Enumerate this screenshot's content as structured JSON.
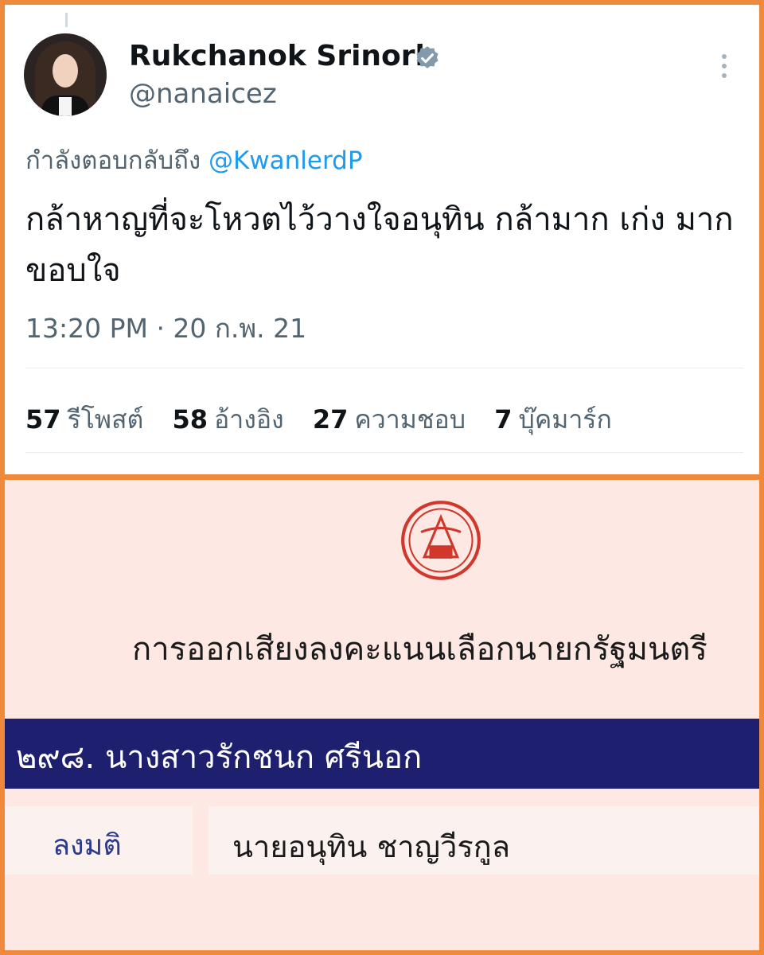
{
  "tweet": {
    "display_name": "Rukchanok Srinork",
    "handle": "@nanaicez",
    "replying_prefix": "กำลังตอบกลับถึง",
    "replying_to": "@KwanlerdP",
    "text": "กล้าหาญที่จะโหวตไว้วางใจอนุทิน กล้ามาก เก่ง มาก ขอบใจ",
    "timestamp": "13:20 PM · 20 ก.พ. 21",
    "stats": [
      {
        "count": "57",
        "label": "รีโพสต์"
      },
      {
        "count": "58",
        "label": "อ้างอิง"
      },
      {
        "count": "27",
        "label": "ความชอบ"
      },
      {
        "count": "7",
        "label": "บุ๊คมาร์ก"
      }
    ],
    "icons": {
      "verified": "verified-badge-icon",
      "more": "more-options-icon"
    }
  },
  "vote_record": {
    "title": "การออกเสียงลงคะแนนเลือกนายกรัฐมนตรี",
    "member": "๒๙๘. นางสาวรักชนก  ศรีนอก",
    "vote_label": "ลงมติ",
    "vote_value": "นายอนุทิน ชาญวีรกูล",
    "icons": {
      "seal": "parliament-seal-icon"
    }
  },
  "colors": {
    "frame": "#ef8a3c",
    "mention": "#1d9bf0",
    "verified": "#829aab",
    "name_bar": "#1e1f6e",
    "vote_bg": "#fde8e3",
    "seal": "#d2372c"
  }
}
